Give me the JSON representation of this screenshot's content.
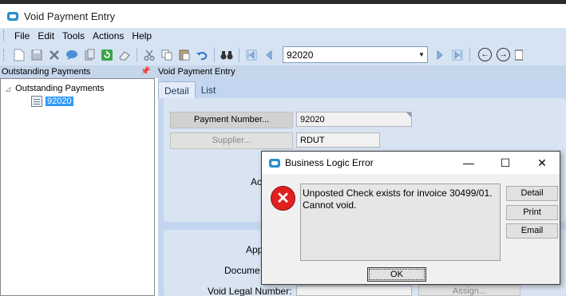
{
  "window": {
    "title": "Void Payment Entry"
  },
  "menu": [
    "File",
    "Edit",
    "Tools",
    "Actions",
    "Help"
  ],
  "toolbar": {
    "record_combo_value": "92020",
    "nav_prev_icon": "circle-arrow-left-icon",
    "nav_next_icon": "circle-arrow-right-icon"
  },
  "left_panel": {
    "header": "Outstanding Payments",
    "tree_root": "Outstanding Payments",
    "tree_item": "92020"
  },
  "right_panel": {
    "header": "Void Payment Entry",
    "tabs": [
      "Detail",
      "List"
    ],
    "payment_number_button": "Payment Number...",
    "payment_number_value": "92020",
    "supplier_button": "Supplier...",
    "supplier_value": "RDUT",
    "partial_label_ac": "Ac",
    "partial_label_app": "App",
    "partial_label_docume": "Docume",
    "void_legal_number_label": "Void Legal Number:",
    "assign_button": "Assign..."
  },
  "dialog": {
    "title": "Business Logic Error",
    "message": "Unposted Check exists for invoice 30499/01. Cannot void.",
    "buttons": {
      "detail": "Detail",
      "print": "Print",
      "email": "Email",
      "ok": "OK"
    }
  },
  "colors": {
    "menubar_bg": "#d6e3f3",
    "panel_bg": "#c4d6ef",
    "error_red": "#e02020",
    "selection": "#3399ff"
  }
}
